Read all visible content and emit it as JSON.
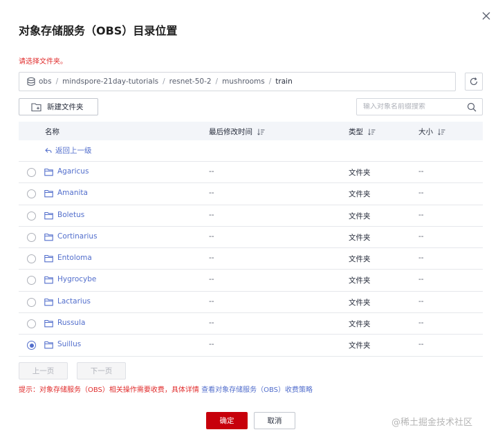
{
  "dialog": {
    "title": "对象存储服务（OBS）目录位置",
    "hint": "请选择文件夹。"
  },
  "path": {
    "root": "obs",
    "segments": [
      "mindspore-21day-tutorials",
      "resnet-50-2",
      "mushrooms",
      "train"
    ],
    "separator": "/"
  },
  "toolbar": {
    "new_folder_label": "新建文件夹",
    "search_placeholder": "输入对象名前缀搜索"
  },
  "table": {
    "headers": {
      "name": "名称",
      "modified": "最后修改时间",
      "type": "类型",
      "size": "大小"
    },
    "back_label": "返回上一级",
    "rows": [
      {
        "name": "Agaricus",
        "modified": "--",
        "type": "文件夹",
        "size": "--",
        "selected": false
      },
      {
        "name": "Amanita",
        "modified": "--",
        "type": "文件夹",
        "size": "--",
        "selected": false
      },
      {
        "name": "Boletus",
        "modified": "--",
        "type": "文件夹",
        "size": "--",
        "selected": false
      },
      {
        "name": "Cortinarius",
        "modified": "--",
        "type": "文件夹",
        "size": "--",
        "selected": false
      },
      {
        "name": "Entoloma",
        "modified": "--",
        "type": "文件夹",
        "size": "--",
        "selected": false
      },
      {
        "name": "Hygrocybe",
        "modified": "--",
        "type": "文件夹",
        "size": "--",
        "selected": false
      },
      {
        "name": "Lactarius",
        "modified": "--",
        "type": "文件夹",
        "size": "--",
        "selected": false
      },
      {
        "name": "Russula",
        "modified": "--",
        "type": "文件夹",
        "size": "--",
        "selected": false
      },
      {
        "name": "Suillus",
        "modified": "--",
        "type": "文件夹",
        "size": "--",
        "selected": true
      }
    ]
  },
  "pagination": {
    "prev_label": "上一页",
    "next_label": "下一页"
  },
  "notice": {
    "text": "提示：对象存储服务（OBS）相关操作需要收费，具体详情 ",
    "link": "查看对象存储服务（OBS）收费策略"
  },
  "footer": {
    "confirm_label": "确定",
    "cancel_label": "取消"
  },
  "watermark": "@稀土掘金技术社区",
  "colors": {
    "accent": "#526ecc",
    "brand_red": "#c7000b",
    "error_red": "#e02c2c",
    "header_bg": "#f3f5f9"
  }
}
